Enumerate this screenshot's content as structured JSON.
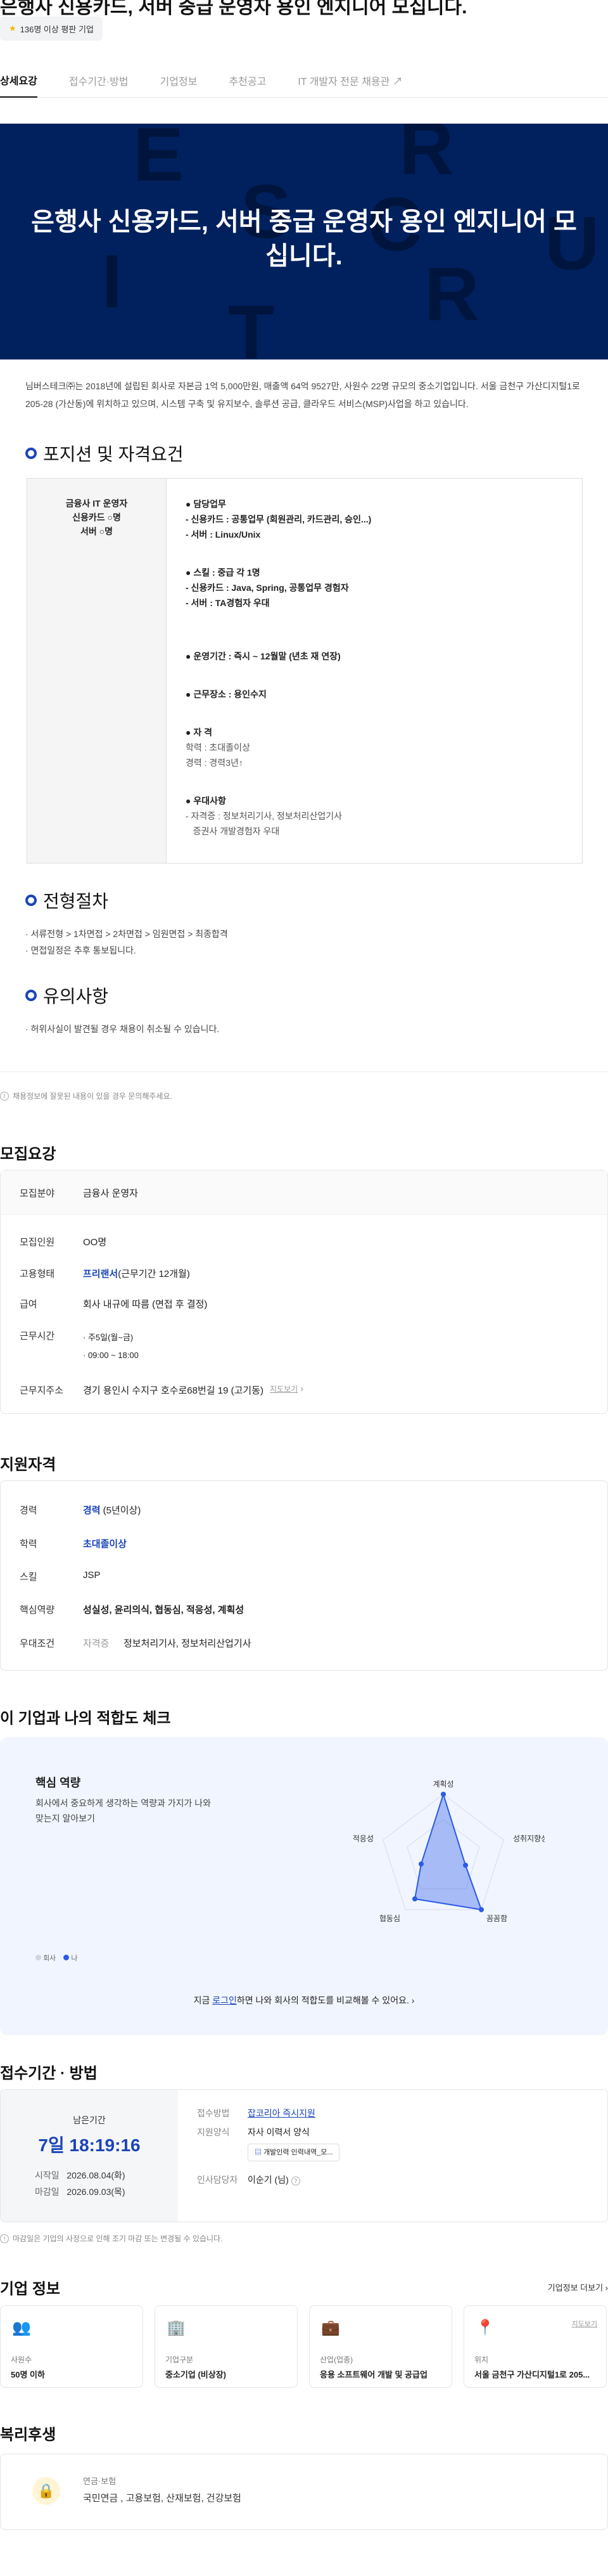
{
  "header": {
    "title": "은행사 신용카드, 서버 중급 운영자 용인 엔지니어 모십니다.",
    "badge": "136명 이상 평판 기업"
  },
  "tabs": [
    "상세요강",
    "접수기간·방법",
    "기업정보",
    "추천공고",
    "IT 개발자 전문 채용관"
  ],
  "hero": {
    "title": "은행사 신용카드, 서버 중급 운영자 용인 엔지니어 모십니다.",
    "bg_letters": [
      "E",
      "R",
      "S",
      "C",
      "U",
      "I",
      "R",
      "T"
    ]
  },
  "intro": "님버스테크㈜는 2018년에 설립된 회사로 자본금 1억 5,000만원, 매출액 64억 9527만, 사원수 22명 규모의 중소기업입니다. 서울 금천구 가산디지털1로 205-28 (가산동)에 위치하고 있으며, 시스템 구축 및 유지보수, 솔루션 공급, 클라우드 서비스(MSP)사업을 하고 있습니다.",
  "position": {
    "heading": "포지션 및 자격요건",
    "left": [
      "금융사 IT 운영자",
      "신용카드 ○명",
      "서버 ○명"
    ],
    "duty_title": "● 담당업무",
    "duty": [
      "- 신용카드 : 공통업무 (회원관리, 카드관리, 승인...)",
      "- 서버 : Linux/Unix"
    ],
    "skill_title": "● 스킬 : 중급  각 1명",
    "skill": [
      "- 신용카드 : Java, Spring,  공통업무 경험자",
      "- 서버 : TA경험자 우대"
    ],
    "period": "● 운영기간 :  즉시 ~ 12월말 (년초 재 연장)",
    "place": "● 근무장소 : 용인수지",
    "qual_title": "● 자  격",
    "qual": [
      "학력 : 초대졸이상",
      "경력 : 경력3년↑"
    ],
    "pref_title": "● 우대사항",
    "pref": [
      "- 자격증 : 정보처리기사, 정보처리산업기사",
      "   증권사 개발경험자 우대"
    ]
  },
  "process": {
    "heading": "전형절차",
    "lines": [
      "· 서류전형 > 1차면접 > 2차면접 > 임원면접 > 최종합격",
      "· 면접일정은 추후 통보됩니다."
    ]
  },
  "caution": {
    "heading": "유의사항",
    "lines": [
      "· 허위사실이 발견될 경우 채용이 취소될 수 있습니다."
    ]
  },
  "notice": "채용정보에 잘못된 내용이 있을 경우 문의해주세요.",
  "recruit": {
    "title": "모집요강",
    "field_k": "모집분야",
    "field_v": "금융사 운영자",
    "rows": [
      {
        "k": "모집인원",
        "v": "OO명"
      },
      {
        "k": "고용형태",
        "v": "(근무기간 12개월)",
        "blue": "프리랜서"
      },
      {
        "k": "급여",
        "v": "회사 내규에 따름 (면접 후 결정)"
      },
      {
        "k": "근무시간",
        "v": "· 주5일(월~금)",
        "v2": "· 09:00 ~ 18:00"
      },
      {
        "k": "근무지주소",
        "v": "경기 용인시 수지구 호수로68번길 19 (고기동)",
        "link": "지도보기"
      }
    ]
  },
  "support": {
    "title": "지원자격",
    "rows": [
      {
        "k": "경력",
        "blue": "경력",
        "v": "(5년이상)"
      },
      {
        "k": "학력",
        "blue": "초대졸이상",
        "v": ""
      },
      {
        "k": "스킬",
        "v": "JSP"
      },
      {
        "k": "핵심역량",
        "v": "성실성, 윤리의식, 협동심, 적응성, 계획성"
      },
      {
        "k": "우대조건",
        "sub": "자격증",
        "v": "정보처리기사, 정보처리산업기사"
      }
    ]
  },
  "fit": {
    "title": "이 기업과 나의 적합도 체크",
    "sub": "핵심 역량",
    "desc": "회사에서 중요하게 생각하는 역량과 가지가 나와 맞는지 알아보기",
    "axes": [
      "계획성",
      "성취지향성",
      "꼼꼼함",
      "협동심",
      "적응성"
    ],
    "legend_company": "회사",
    "legend_me": "나",
    "cta_pre": "지금",
    "cta_link": "로그인",
    "cta_post": "하면 나와 회사의 적합도를 비교해볼 수 있어요."
  },
  "apply": {
    "title": "접수기간 · 방법",
    "remain_label": "남은기간",
    "remain": "7일 18:19:16",
    "start_k": "시작일",
    "start_v": "2026.08.04(화)",
    "end_k": "마감일",
    "end_v": "2026.09.03(목)",
    "method_k": "접수방법",
    "method_v": "잡코리아 즉시지원",
    "form_k": "지원양식",
    "form_v": "자사 이력서 양식",
    "form_btn": "개발인력 인력내역_모...",
    "manager_k": "인사담당자",
    "manager_v": "이순기 (님)",
    "note": "마감일은 기업의 사정으로 인해 조기 마감 또는 변경될 수 있습니다."
  },
  "company": {
    "title": "기업 정보",
    "more": "기업정보 더보기",
    "cards": [
      {
        "icon": "👥",
        "label": "사원수",
        "value": "50명 이하"
      },
      {
        "icon": "🏢",
        "label": "기업구분",
        "value": "중소기업 (비상장)"
      },
      {
        "icon": "💼",
        "label": "산업(업종)",
        "value": "응용 소프트웨어 개발 및 공급업"
      },
      {
        "icon": "📍",
        "label": "위치",
        "value": "서울 금천구 가산디지털1로 205...",
        "link": "지도보기"
      }
    ]
  },
  "welfare": {
    "title": "복리후생",
    "label": "연금·보험",
    "value": "국민연금 , 고용보험, 산재보험, 건강보험"
  }
}
